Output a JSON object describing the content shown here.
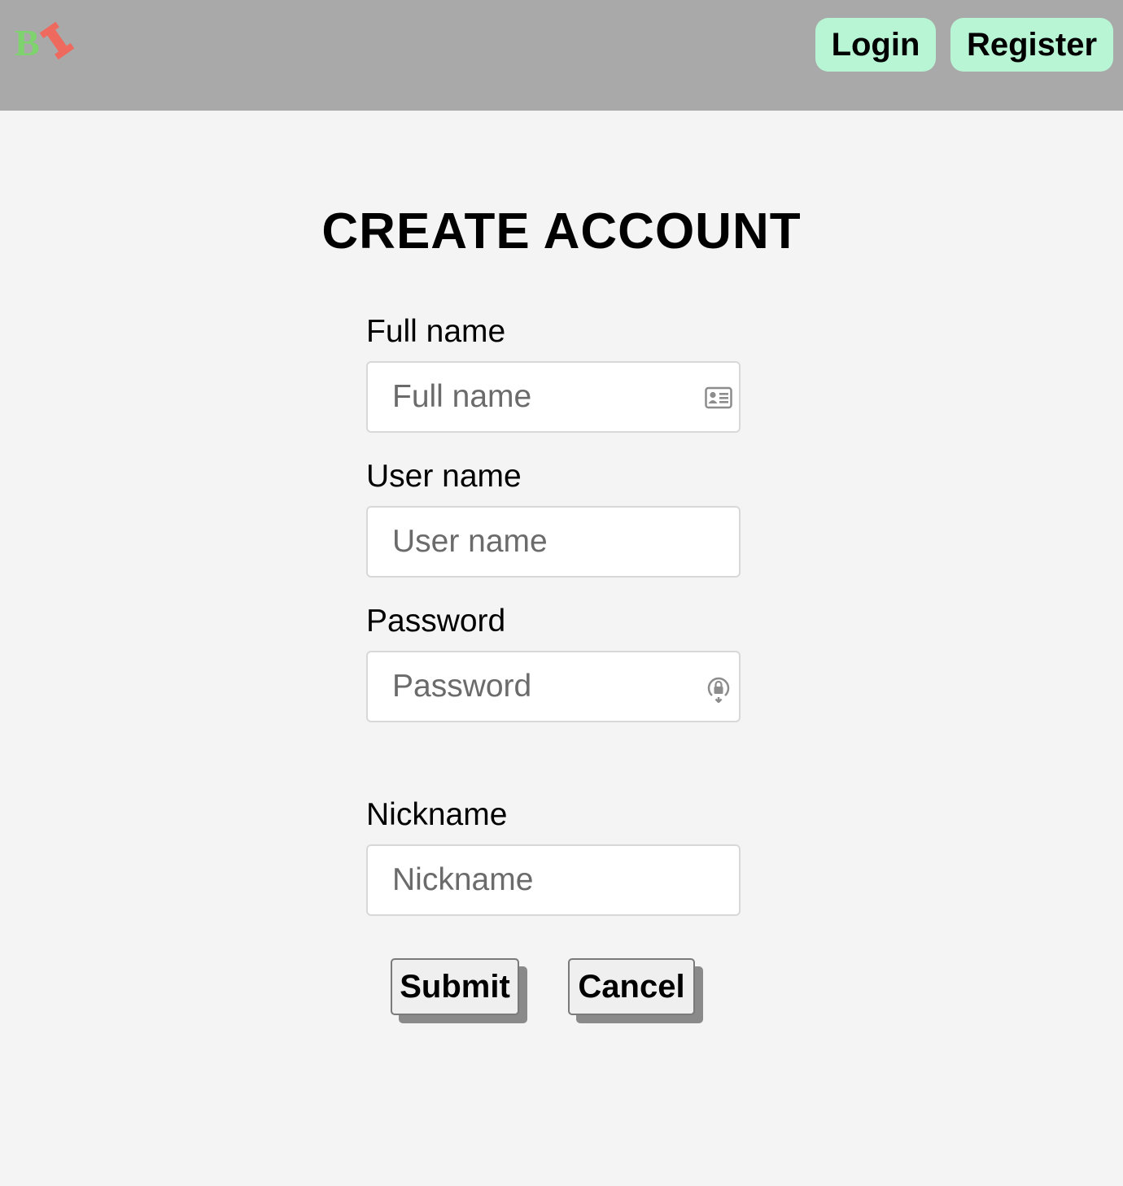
{
  "header": {
    "logo_icon": "bi-logo-icon",
    "logo_colors": {
      "b": "#7ed36f",
      "i": "#ee6a5e"
    },
    "nav": {
      "login_label": "Login",
      "register_label": "Register"
    },
    "nav_button_color": "#b8f5d5",
    "background_color": "#a9a9a9"
  },
  "form": {
    "title": "CREATE ACCOUNT",
    "fields": {
      "full_name": {
        "label": "Full name",
        "placeholder": "Full name",
        "value": "",
        "icon": "contact-card-icon"
      },
      "user_name": {
        "label": "User name",
        "placeholder": "User name",
        "value": ""
      },
      "password": {
        "label": "Password",
        "placeholder": "Password",
        "value": "",
        "icon": "password-autofill-lock-icon"
      },
      "nickname": {
        "label": "Nickname",
        "placeholder": "Nickname",
        "value": ""
      }
    },
    "actions": {
      "submit_label": "Submit",
      "cancel_label": "Cancel"
    }
  }
}
